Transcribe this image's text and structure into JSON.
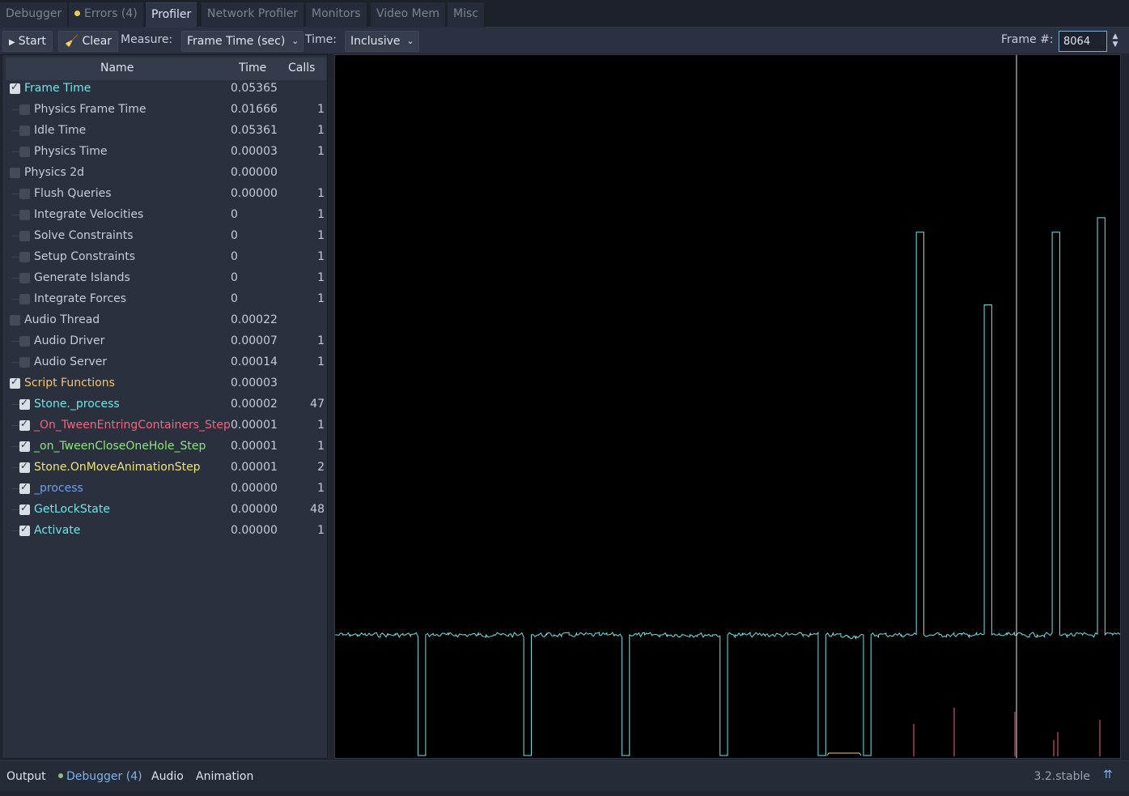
{
  "tabs": [
    {
      "label": "Debugger",
      "active": false
    },
    {
      "label": "Errors (4)",
      "active": false,
      "dot_color": "#f5c84b"
    },
    {
      "label": "Profiler",
      "active": true
    },
    {
      "label": "Network Profiler",
      "active": false
    },
    {
      "label": "Monitors",
      "active": false
    },
    {
      "label": "Video Mem",
      "active": false
    },
    {
      "label": "Misc",
      "active": false
    }
  ],
  "toolbar": {
    "start_label": "Start",
    "clear_label": "Clear",
    "measure_label": "Measure:",
    "measure_value": "Frame Time (sec)",
    "time_label": "Time:",
    "time_value": "Inclusive",
    "frame_label": "Frame #:",
    "frame_value": "8064"
  },
  "tree": {
    "headers": {
      "name": "Name",
      "time": "Time",
      "calls": "Calls"
    },
    "rows": [
      {
        "name": "Frame Time",
        "time": "0.05365",
        "calls": "",
        "level": 0,
        "checked": true,
        "color": "#6fe3e6"
      },
      {
        "name": "Physics Frame Time",
        "time": "0.01666",
        "calls": "1",
        "level": 1,
        "checked": false,
        "color": "#c6ccd7"
      },
      {
        "name": "Idle Time",
        "time": "0.05361",
        "calls": "1",
        "level": 1,
        "checked": false,
        "color": "#c6ccd7"
      },
      {
        "name": "Physics Time",
        "time": "0.00003",
        "calls": "1",
        "level": 1,
        "checked": false,
        "color": "#c6ccd7"
      },
      {
        "name": "Physics 2d",
        "time": "0.00000",
        "calls": "",
        "level": 0,
        "checked": false,
        "color": "#c6ccd7"
      },
      {
        "name": "Flush Queries",
        "time": "0.00000",
        "calls": "1",
        "level": 1,
        "checked": false,
        "color": "#c6ccd7"
      },
      {
        "name": "Integrate Velocities",
        "time": "0",
        "calls": "1",
        "level": 1,
        "checked": false,
        "color": "#c6ccd7"
      },
      {
        "name": "Solve Constraints",
        "time": "0",
        "calls": "1",
        "level": 1,
        "checked": false,
        "color": "#c6ccd7"
      },
      {
        "name": "Setup Constraints",
        "time": "0",
        "calls": "1",
        "level": 1,
        "checked": false,
        "color": "#c6ccd7"
      },
      {
        "name": "Generate Islands",
        "time": "0",
        "calls": "1",
        "level": 1,
        "checked": false,
        "color": "#c6ccd7"
      },
      {
        "name": "Integrate Forces",
        "time": "0",
        "calls": "1",
        "level": 1,
        "checked": false,
        "color": "#c6ccd7"
      },
      {
        "name": "Audio Thread",
        "time": "0.00022",
        "calls": "",
        "level": 0,
        "checked": false,
        "color": "#c6ccd7"
      },
      {
        "name": "Audio Driver",
        "time": "0.00007",
        "calls": "1",
        "level": 1,
        "checked": false,
        "color": "#c6ccd7"
      },
      {
        "name": "Audio Server",
        "time": "0.00014",
        "calls": "1",
        "level": 1,
        "checked": false,
        "color": "#c6ccd7"
      },
      {
        "name": "Script Functions",
        "time": "0.00003",
        "calls": "",
        "level": 0,
        "checked": true,
        "color": "#f0c76a"
      },
      {
        "name": "Stone._process",
        "time": "0.00002",
        "calls": "47",
        "level": 1,
        "checked": true,
        "color": "#6fe3e6"
      },
      {
        "name": "_On_TweenEntringContainers_Step",
        "time": "0.00001",
        "calls": "1",
        "level": 1,
        "checked": true,
        "color": "#f0667f"
      },
      {
        "name": "_on_TweenCloseOneHole_Step",
        "time": "0.00001",
        "calls": "1",
        "level": 1,
        "checked": true,
        "color": "#8ee57a"
      },
      {
        "name": "Stone.OnMoveAnimationStep",
        "time": "0.00001",
        "calls": "2",
        "level": 1,
        "checked": true,
        "color": "#f0e27a"
      },
      {
        "name": "_process",
        "time": "0.00000",
        "calls": "1",
        "level": 1,
        "checked": true,
        "color": "#6f9ef0"
      },
      {
        "name": "GetLockState",
        "time": "0.00000",
        "calls": "48",
        "level": 1,
        "checked": true,
        "color": "#6fe3e6"
      },
      {
        "name": "Activate",
        "time": "0.00000",
        "calls": "1",
        "level": 1,
        "checked": true,
        "color": "#6fe3e6"
      }
    ]
  },
  "bottom": {
    "tabs": [
      {
        "label": "Output",
        "active": false
      },
      {
        "label": "Debugger (4)",
        "active": true,
        "dot_color": "#8ec07c"
      },
      {
        "label": "Audio",
        "active": false
      },
      {
        "label": "Animation",
        "active": false
      }
    ],
    "version": "3.2.stable"
  },
  "colors": {
    "frame_line": "#6fe3e6",
    "script_line": "#f0c76a",
    "tween_line": "#f0667f",
    "cursor_line": "#e6e6e6"
  },
  "chart_data": {
    "type": "line",
    "series": [
      {
        "values": [
          0.83,
          0.83,
          0.83,
          0.83,
          0.83,
          0.83,
          0.83,
          0.83,
          0.83,
          0.83,
          0.83,
          0.0,
          0.83,
          0.83,
          0.83,
          0.83,
          0.83,
          0.83,
          0.83,
          0.83,
          0.83,
          0.83,
          0.83,
          0.83,
          0.83,
          0.0,
          0.83,
          0.83,
          0.83,
          0.83,
          0.83,
          0.83,
          0.83,
          0.83,
          0.83,
          0.83,
          0.83,
          0.83,
          0.0,
          0.83,
          0.83,
          0.83,
          0.83,
          0.83,
          0.83,
          0.83,
          0.83,
          0.83,
          0.83,
          0.83,
          0.83,
          0.0,
          0.83,
          0.83,
          0.83,
          0.83,
          0.83,
          0.83,
          0.83,
          0.83,
          0.83,
          0.83,
          0.83,
          0.83,
          0.0,
          0.83,
          0.83,
          0.82,
          0.82,
          0.82,
          0.0,
          0.83,
          0.83,
          0.83,
          0.83,
          0.83,
          0.83,
          3.6,
          0.83,
          0.83,
          0.83,
          0.83,
          0.83,
          0.83,
          0.83,
          0.83,
          3.1,
          0.83,
          0.83,
          0.83,
          0.83,
          0.83,
          0.83,
          0.83,
          0.83,
          3.6,
          0.83,
          0.83,
          0.83,
          0.83,
          0.83,
          3.7,
          0.83,
          0.83
        ]
      }
    ],
    "cursor_frame": 8064,
    "ylim": [
      0,
      4.0
    ]
  }
}
